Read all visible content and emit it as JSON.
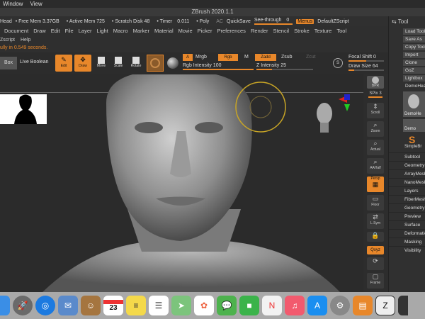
{
  "mac_menubar": {
    "items": [
      "Window",
      "View"
    ]
  },
  "titlebar": {
    "title": "ZBrush 2020.1.1"
  },
  "infobar": {
    "head": "Head",
    "free_mem": "Free Mem 3.37GB",
    "active_mem": "Active Mem 725",
    "scratch": "Scratch Disk 48",
    "timer": "Timer",
    "timer_val": "0.011",
    "poly": "Poly",
    "ac": "AC",
    "quicksave": "QuickSave",
    "see_through": "See-through",
    "see_through_val": "0",
    "menus": "Menus",
    "default_zscript": "DefaultZScript"
  },
  "menus": [
    "Document",
    "Draw",
    "Edit",
    "File",
    "Layer",
    "Light",
    "Macro",
    "Marker",
    "Material",
    "Movie",
    "Picker",
    "Preferences",
    "Render",
    "Stencil",
    "Stroke",
    "Texture",
    "Tool"
  ],
  "menus2": [
    "Zscript",
    "Help"
  ],
  "status": "ully in 0.549 seconds.",
  "toolbar": {
    "box": "Box",
    "live_boolean": "Live Boolean",
    "edit": "Edit",
    "draw": "Draw",
    "move": "Move",
    "scale": "Scale",
    "rotate": "Rotate",
    "a": "A",
    "mrgb": "Mrgb",
    "rgb": "Rgb",
    "m": "M",
    "zadd": "Zadd",
    "zsub": "Zsub",
    "zcut": "Zcut",
    "rgb_intensity": "Rgb Intensity 100",
    "z_intensity": "Z Intensity 25",
    "focal_shift": "Focal Shift",
    "focal_shift_val": "0",
    "draw_size": "Draw Size",
    "draw_size_val": "64"
  },
  "shelf": {
    "bpr": "BPR",
    "spix": "SPix",
    "spix_val": "3",
    "scroll": "Scroll",
    "zoom": "Zoom",
    "actual": "Actual",
    "aahalf": "AAHalf",
    "persp": "Persp",
    "floor": "Floor",
    "lsym": "L.Sym",
    "xyz": "Qxyz",
    "frame": "Frame"
  },
  "tray": {
    "title": "Tool",
    "buttons": [
      "Load Tool",
      "Save As",
      "Copy Tool",
      "Import",
      "Clone",
      "GoZ",
      "Lightbox",
      "DemoHead"
    ],
    "thumb1": "DemoHe",
    "thumb2": "Demo",
    "simple_brush": "SimpleBr",
    "items": [
      "Subtool",
      "Geometry",
      "ArrayMesh",
      "NanoMesh",
      "Layers",
      "FiberMesh",
      "Geometry",
      "Preview",
      "Surface",
      "Deformation",
      "Masking",
      "Visibility"
    ]
  },
  "dock_icons": [
    "launchpad",
    "safari",
    "mail",
    "contacts",
    "calendar",
    "notes",
    "reminders",
    "maps",
    "photos",
    "messages",
    "facetime",
    "news",
    "music",
    "appstore",
    "prefs",
    "books",
    "zbrush",
    "more"
  ],
  "calendar_date": "23"
}
